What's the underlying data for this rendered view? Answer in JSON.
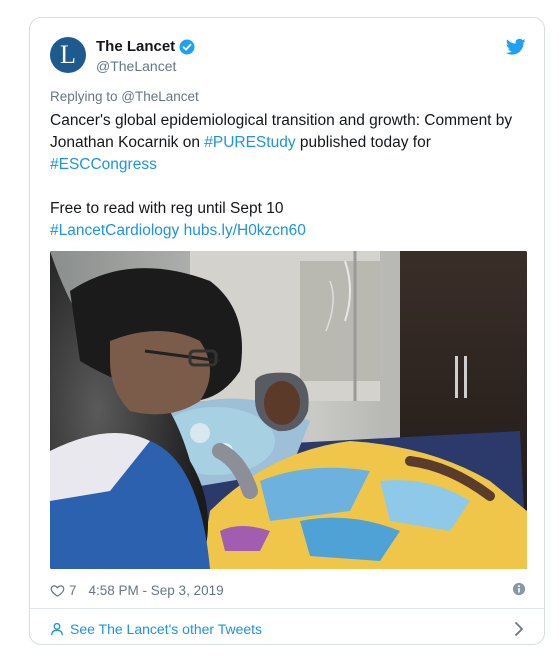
{
  "author": {
    "name": "The Lancet",
    "handle": "@TheLancet",
    "avatar_letter": "L",
    "verified_icon": "verified-badge-icon"
  },
  "replying_to": "Replying to @TheLancet",
  "tweet": {
    "line1": "Cancer's global epidemiological transition and growth: Comment by Jonathan Kocarnik on ",
    "hashtag1": "#PUREStudy",
    "line1b": " published today for ",
    "hashtag2": "#ESCCongress",
    "line2": "Free to read with reg until Sept 10",
    "hashtag3": "#LancetCardiology",
    "link": "hubs.ly/H0kzcn60"
  },
  "footer": {
    "likes": "7",
    "timestamp": "4:58 PM - Sep 3, 2019"
  },
  "see_more": "See The Lancet's other Tweets",
  "colors": {
    "link": "#1b95e0",
    "avatar_bg": "#1d5a8e",
    "text": "#14171a",
    "muted": "#657786"
  }
}
